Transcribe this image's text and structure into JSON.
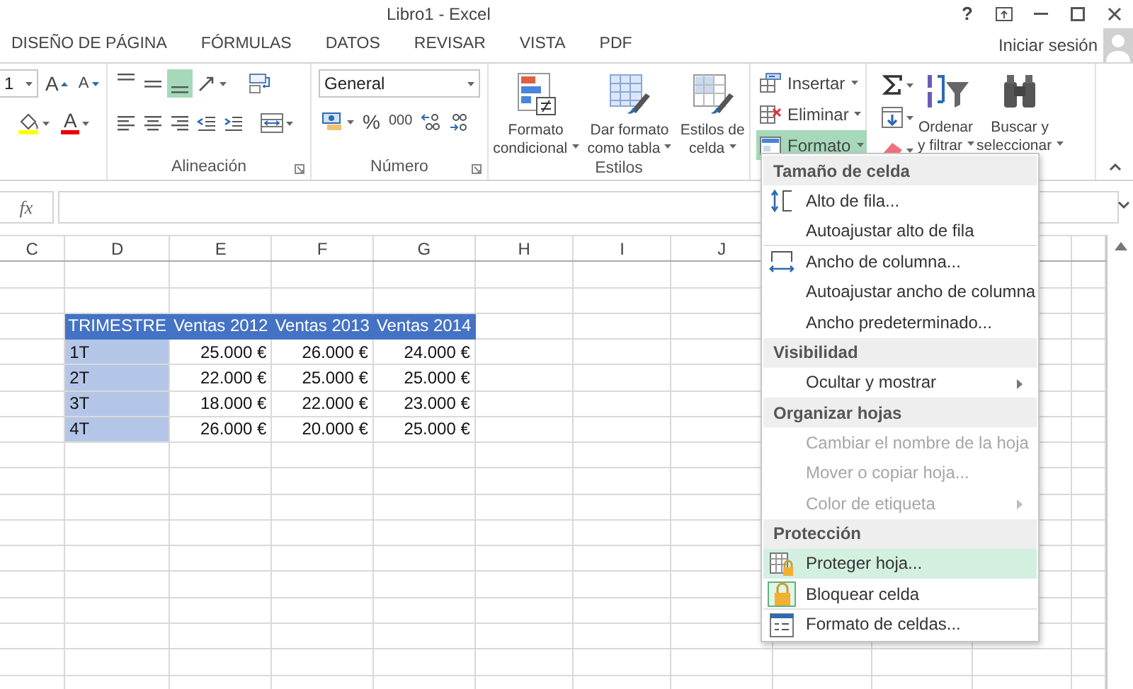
{
  "window": {
    "title": "Libro1 - Excel",
    "help": "?"
  },
  "tabs": [
    {
      "label": "DISEÑO DE PÁGINA",
      "selected": false
    },
    {
      "label": "FÓRMULAS",
      "selected": false
    },
    {
      "label": "DATOS",
      "selected": false
    },
    {
      "label": "REVISAR",
      "selected": false
    },
    {
      "label": "VISTA",
      "selected": false
    },
    {
      "label": "PDF",
      "selected": false
    }
  ],
  "account": {
    "sign_in": "Iniciar sesión"
  },
  "ribbon": {
    "font": {
      "size": "1",
      "grow": "A",
      "shrink": "A",
      "color_letter": "A"
    },
    "alignment": {
      "label": "Alineación",
      "vertical": [
        {
          "selected": false
        },
        {
          "selected": false
        },
        {
          "selected": true
        }
      ]
    },
    "number": {
      "label": "Número",
      "format": "General",
      "percent": "%",
      "thousands": "000"
    },
    "styles": {
      "label": "Estilos",
      "buttons": [
        {
          "lines": [
            "Formato",
            "condicional"
          ]
        },
        {
          "lines": [
            "Dar formato",
            "como tabla"
          ]
        },
        {
          "lines": [
            "Estilos de",
            "celda"
          ]
        }
      ]
    },
    "cells": {
      "buttons": [
        {
          "label": "Insertar",
          "selected": false
        },
        {
          "label": "Eliminar",
          "selected": false
        },
        {
          "label": "Formato",
          "selected": true
        }
      ]
    },
    "editing": {
      "buttons": [
        {
          "lines": [
            "Ordenar",
            "y filtrar"
          ]
        },
        {
          "lines": [
            "Buscar y",
            "seleccionar"
          ]
        }
      ]
    }
  },
  "formula_bar": {
    "function_label": "fx"
  },
  "sheet": {
    "columns": [
      "C",
      "D",
      "E",
      "F",
      "G",
      "H",
      "I",
      "J"
    ],
    "rows": [
      {
        "kind": "header",
        "cells": [
          "",
          "TRIMESTRE",
          "Ventas 2012",
          "Ventas 2013",
          "Ventas 2014"
        ]
      },
      {
        "kind": "data",
        "cells": [
          "",
          "1T",
          "25.000 €",
          "26.000 €",
          "24.000 €"
        ]
      },
      {
        "kind": "data",
        "cells": [
          "",
          "2T",
          "22.000 €",
          "25.000 €",
          "25.000 €"
        ]
      },
      {
        "kind": "data",
        "cells": [
          "",
          "3T",
          "18.000 €",
          "22.000 €",
          "23.000 €"
        ]
      },
      {
        "kind": "data",
        "cells": [
          "",
          "4T",
          "26.000 €",
          "20.000 €",
          "25.000 €"
        ]
      }
    ]
  },
  "menu": {
    "sections": [
      {
        "title": "Tamaño de celda",
        "items": [
          {
            "label": "Alto de fila...",
            "kind": "row-height",
            "disabled": false,
            "selected": false,
            "checked": false,
            "submenu": false,
            "separator_after": false
          },
          {
            "label": "Autoajustar alto de fila",
            "kind": "plain",
            "disabled": false,
            "selected": false,
            "checked": false,
            "submenu": false,
            "separator_after": true
          },
          {
            "label": "Ancho de columna...",
            "kind": "column-width",
            "disabled": false,
            "selected": false,
            "checked": false,
            "submenu": false,
            "separator_after": false
          },
          {
            "label": "Autoajustar ancho de columna",
            "kind": "plain",
            "disabled": false,
            "selected": false,
            "checked": false,
            "submenu": false,
            "separator_after": false
          },
          {
            "label": "Ancho predeterminado...",
            "kind": "plain",
            "disabled": false,
            "selected": false,
            "checked": false,
            "submenu": false,
            "separator_after": false
          }
        ]
      },
      {
        "title": "Visibilidad",
        "items": [
          {
            "label": "Ocultar y mostrar",
            "kind": "plain",
            "disabled": false,
            "selected": false,
            "checked": false,
            "submenu": true,
            "separator_after": false
          }
        ]
      },
      {
        "title": "Organizar hojas",
        "items": [
          {
            "label": "Cambiar el nombre de la hoja",
            "kind": "plain",
            "disabled": true,
            "selected": false,
            "checked": false,
            "submenu": false,
            "separator_after": false
          },
          {
            "label": "Mover o copiar hoja...",
            "kind": "plain",
            "disabled": true,
            "selected": false,
            "checked": false,
            "submenu": false,
            "separator_after": false
          },
          {
            "label": "Color de etiqueta",
            "kind": "plain",
            "disabled": true,
            "selected": false,
            "checked": false,
            "submenu": true,
            "separator_after": false
          }
        ]
      },
      {
        "title": "Protección",
        "items": [
          {
            "label": "Proteger hoja...",
            "kind": "protect-sheet",
            "disabled": false,
            "selected": true,
            "checked": false,
            "submenu": false,
            "separator_after": false
          },
          {
            "label": "Bloquear celda",
            "kind": "lock",
            "disabled": false,
            "selected": false,
            "checked": true,
            "submenu": false,
            "separator_after": true
          },
          {
            "label": "Formato de celdas...",
            "kind": "format-cells",
            "disabled": false,
            "selected": false,
            "checked": false,
            "submenu": false,
            "separator_after": false
          }
        ]
      }
    ]
  }
}
